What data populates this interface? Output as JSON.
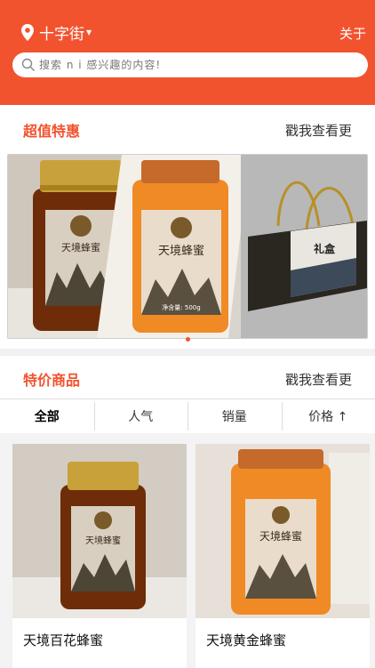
{
  "header": {
    "city": "十字街",
    "about": "关于",
    "search_placeholder": "搜索 n i 感兴趣的内容!"
  },
  "deals": {
    "title": "超值特惠",
    "more": "戳我查看更",
    "label_brand": "天境蜂蜜",
    "label_weight": "净含量: 500g"
  },
  "specials": {
    "title": "特价商品",
    "more": "戳我查看更",
    "tabs": [
      "全部",
      "人气",
      "销量",
      "价格 ↑"
    ]
  },
  "products": [
    {
      "name": "天境百花蜂蜜",
      "label": "天境蜂蜜"
    },
    {
      "name": "天境黄金蜂蜜",
      "label": "天境蜂蜜"
    }
  ],
  "colors": {
    "accent": "#f2532f",
    "honey_dark": "#6e2c08",
    "honey_light": "#f08a25"
  }
}
